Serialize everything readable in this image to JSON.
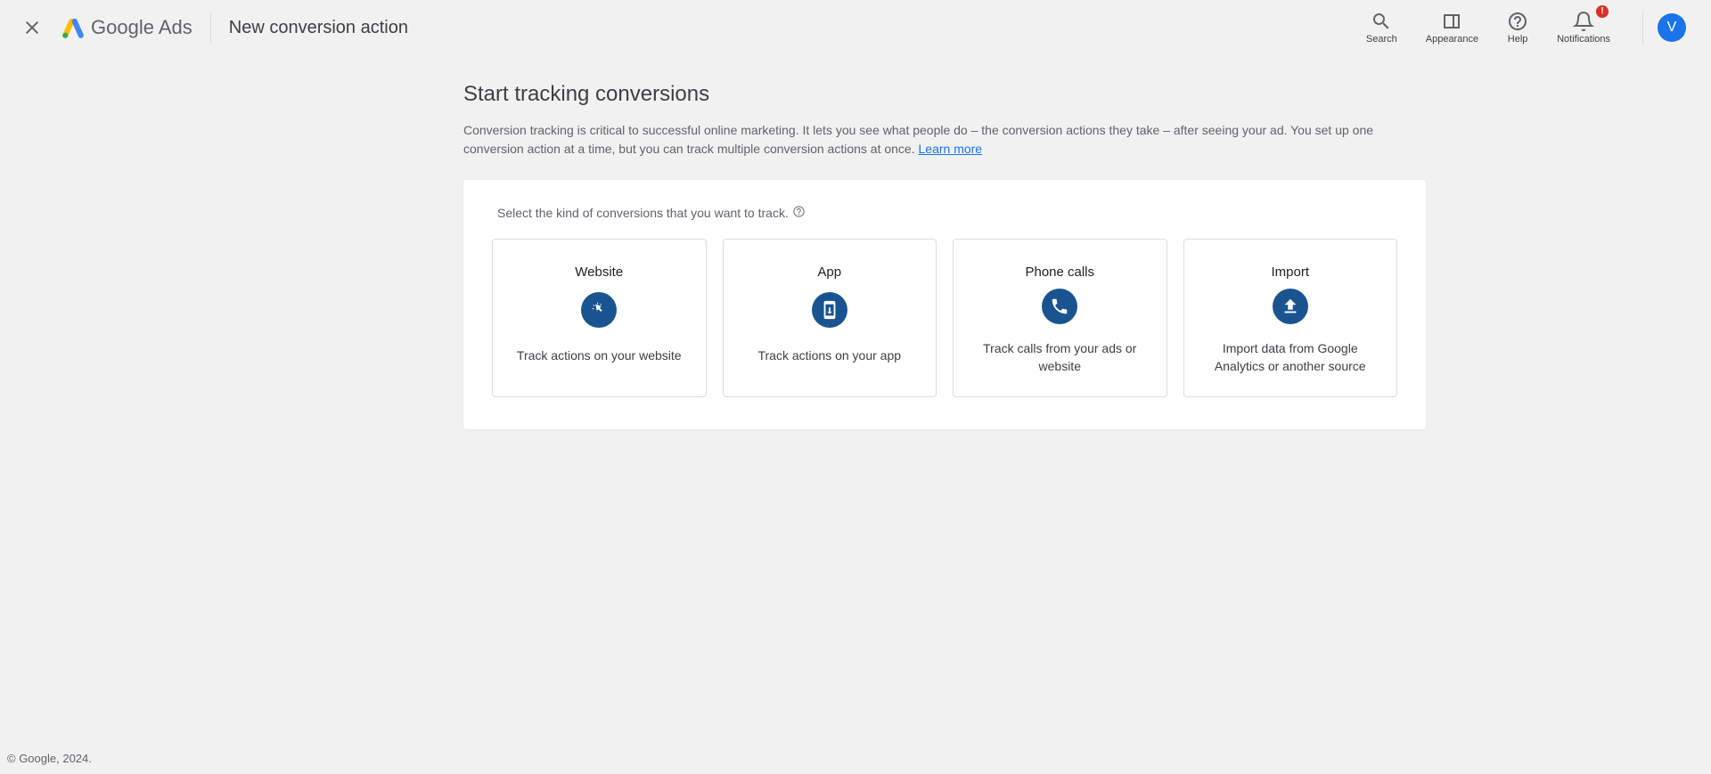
{
  "header": {
    "brand_google": "Google",
    "brand_ads": " Ads",
    "page_title": "New conversion action",
    "actions": {
      "search": "Search",
      "appearance": "Appearance",
      "help": "Help",
      "notifications": "Notifications",
      "notif_badge": "!"
    },
    "avatar_initial": "V"
  },
  "main": {
    "heading": "Start tracking conversions",
    "description": "Conversion tracking is critical to successful online marketing. It lets you see what people do – the conversion actions they take – after seeing your ad. You set up one conversion action at a time, but you can track multiple conversion actions at once.  ",
    "learn_more": "Learn more",
    "panel_instruction": "Select the kind of conversions that you want to track.",
    "options": {
      "website": {
        "title": "Website",
        "desc": "Track actions on your website"
      },
      "app": {
        "title": "App",
        "desc": "Track actions on your app"
      },
      "phone": {
        "title": "Phone calls",
        "desc": "Track calls from your ads or website"
      },
      "import": {
        "title": "Import",
        "desc": "Import data from Google Analytics or another source"
      }
    }
  },
  "footer": {
    "copyright": "© Google, 2024."
  }
}
